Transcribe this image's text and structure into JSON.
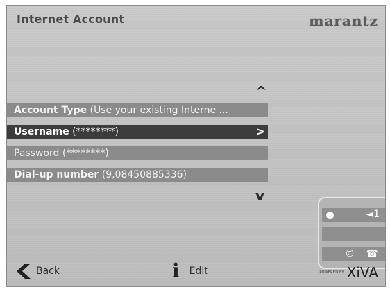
{
  "header": {
    "title": "Internet Account",
    "brand": "marantz"
  },
  "menu": {
    "items": [
      {
        "key": "Account Type",
        "value": "(Use your existing Interne ..."
      },
      {
        "key": "Username",
        "value": "(********)"
      },
      {
        "key": "Password",
        "value": "(********)"
      },
      {
        "key": "Dial-up number",
        "value": "(9,08450885336)"
      }
    ],
    "selected_index": 1,
    "scroll_up_glyph": "^",
    "scroll_down_glyph": "v",
    "selected_arrow": ">"
  },
  "status": {
    "volume_icon": "speaker-icon",
    "volume_text": "◄1",
    "connection_icons": "© ☎"
  },
  "footer": {
    "back_label": "Back",
    "edit_label": "Edit",
    "powered_by": "POWERED BY",
    "powered_brand": "XiVA"
  }
}
